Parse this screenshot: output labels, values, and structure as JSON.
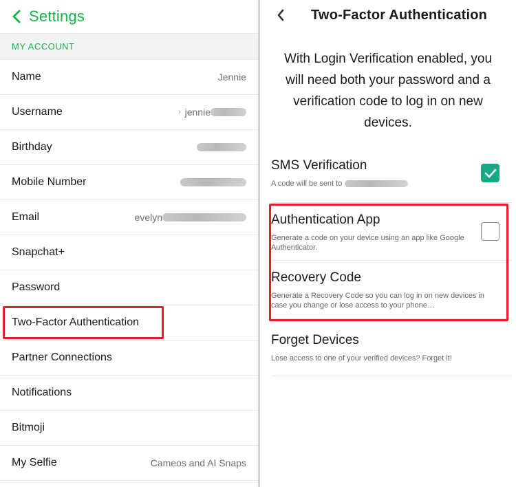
{
  "left": {
    "back_icon": "chevron-left-icon",
    "title": "Settings",
    "section": "MY ACCOUNT",
    "rows": [
      {
        "label": "Name",
        "value": "Jennie"
      },
      {
        "label": "Username",
        "value": "jennie"
      },
      {
        "label": "Birthday",
        "value": ""
      },
      {
        "label": "Mobile Number",
        "value": ""
      },
      {
        "label": "Email",
        "value": "evelyn"
      },
      {
        "label": "Snapchat+",
        "value": ""
      },
      {
        "label": "Password",
        "value": ""
      },
      {
        "label": "Two-Factor Authentication",
        "value": ""
      },
      {
        "label": "Partner Connections",
        "value": ""
      },
      {
        "label": "Notifications",
        "value": ""
      },
      {
        "label": "Bitmoji",
        "value": ""
      },
      {
        "label": "My Selfie",
        "value": "Cameos and AI Snaps"
      }
    ]
  },
  "right": {
    "back_icon": "chevron-left-icon",
    "title": "Two-Factor Authentication",
    "intro": "With Login Verification enabled, you will need both your password and a verification code to log in on new devices.",
    "options": [
      {
        "title": "SMS Verification",
        "desc": "A code will be sent to",
        "checked": true
      },
      {
        "title": "Authentication App",
        "desc": "Generate a code on your device using an app like Google Authenticator.",
        "checked": false
      },
      {
        "title": "Recovery Code",
        "desc": "Generate a Recovery Code so you can log in on new devices in case you change or lose access to your phone…"
      },
      {
        "title": "Forget Devices",
        "desc": "Lose access to one of your verified devices? Forget it!"
      }
    ]
  },
  "colors": {
    "accent_green": "#18b34a",
    "check_teal": "#17a886",
    "highlight_red": "#e0202c"
  }
}
